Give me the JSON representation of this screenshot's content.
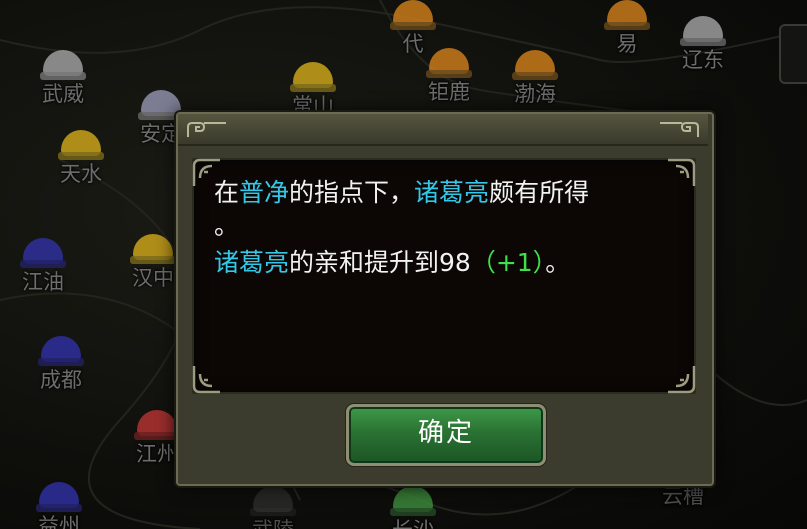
{
  "map": {
    "cities": [
      {
        "name": "武威",
        "color": "#9e9e9e"
      },
      {
        "name": "安定",
        "color": "#8e8eaa"
      },
      {
        "name": "天水",
        "color": "#c9a21a"
      },
      {
        "name": "江油",
        "color": "#2f2f9e"
      },
      {
        "name": "汉中",
        "color": "#c9a21a"
      },
      {
        "name": "成都",
        "color": "#2f2f9e"
      },
      {
        "name": "江州",
        "color": "#b23232"
      },
      {
        "name": "益州",
        "color": "#2f2f9e"
      },
      {
        "name": "代",
        "color": "#c97a1a"
      },
      {
        "name": "常山",
        "color": "#c9a21a"
      },
      {
        "name": "钜鹿",
        "color": "#c97a1a"
      },
      {
        "name": "渤海",
        "color": "#c97a1a"
      },
      {
        "name": "易",
        "color": "#c97a1a"
      },
      {
        "name": "辽东",
        "color": "#9e9e9e"
      },
      {
        "name": "武陵",
        "color": "#555555"
      },
      {
        "name": "长沙",
        "color": "#3c8a3c"
      },
      {
        "name": "云槽",
        "color": "#555555"
      }
    ]
  },
  "dialog": {
    "line1": {
      "pre": "在",
      "teacher": "普净",
      "mid": "的指点下，",
      "hero": "诸葛亮",
      "post": "颇有所得"
    },
    "line1_end": "。",
    "line2": {
      "hero": "诸葛亮",
      "text": "的亲和提升到98",
      "gain": "（+1）",
      "end": "。"
    },
    "ok_label": "确定"
  },
  "colors": {
    "highlight": "#33c7e8",
    "gain": "#3fe04b",
    "button": "#2a7233",
    "frame": "#3b3b2e"
  }
}
